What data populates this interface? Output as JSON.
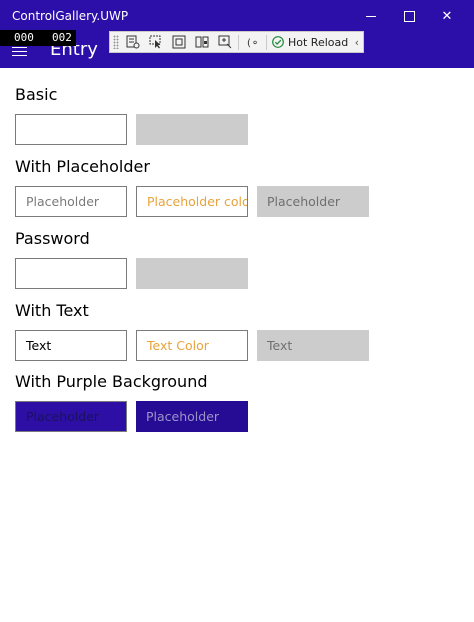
{
  "window": {
    "title": "ControlGallery.UWP",
    "controls": {
      "minimize": "minimize",
      "maximize": "maximize",
      "close": "✕"
    }
  },
  "debug_counter": {
    "left": "000",
    "right": "002"
  },
  "header": {
    "title": "Entry"
  },
  "toolbar": {
    "hot_reload_label": "Hot Reload",
    "collapse_glyph": "‹",
    "icons": [
      "live-visual-tree-icon",
      "select-element-icon",
      "display-layout-adorners-icon",
      "track-focus-icon",
      "binding-failures-icon",
      "xaml-binding-icon",
      "hot-reload-check-icon"
    ]
  },
  "colors": {
    "accent": "#2b0fa8",
    "placeholder_color": "#e8a33c",
    "disabled_fill": "#cccccc",
    "purple_fill": "#2e0fa6"
  },
  "sections": [
    {
      "label": "Basic",
      "entries": [
        {
          "state": "normal",
          "text": ""
        },
        {
          "state": "disabled",
          "text": ""
        }
      ]
    },
    {
      "label": "With Placeholder",
      "entries": [
        {
          "state": "normal",
          "placeholder": "Placeholder"
        },
        {
          "state": "normal",
          "placeholder": "Placeholder colo",
          "color": "#e8a33c"
        },
        {
          "state": "disabled",
          "placeholder": "Placeholder"
        }
      ]
    },
    {
      "label": "Password",
      "entries": [
        {
          "state": "normal",
          "text": ""
        },
        {
          "state": "disabled",
          "text": ""
        }
      ]
    },
    {
      "label": "With Text",
      "entries": [
        {
          "state": "normal",
          "text": "Text"
        },
        {
          "state": "normal",
          "text": "Text Color",
          "color": "#e8a33c"
        },
        {
          "state": "disabled",
          "text": "Text"
        }
      ]
    },
    {
      "label": "With Purple Background",
      "entries": [
        {
          "state": "purple",
          "placeholder": "Placeholder"
        },
        {
          "state": "purple-disabled",
          "placeholder": "Placeholder"
        }
      ]
    }
  ]
}
